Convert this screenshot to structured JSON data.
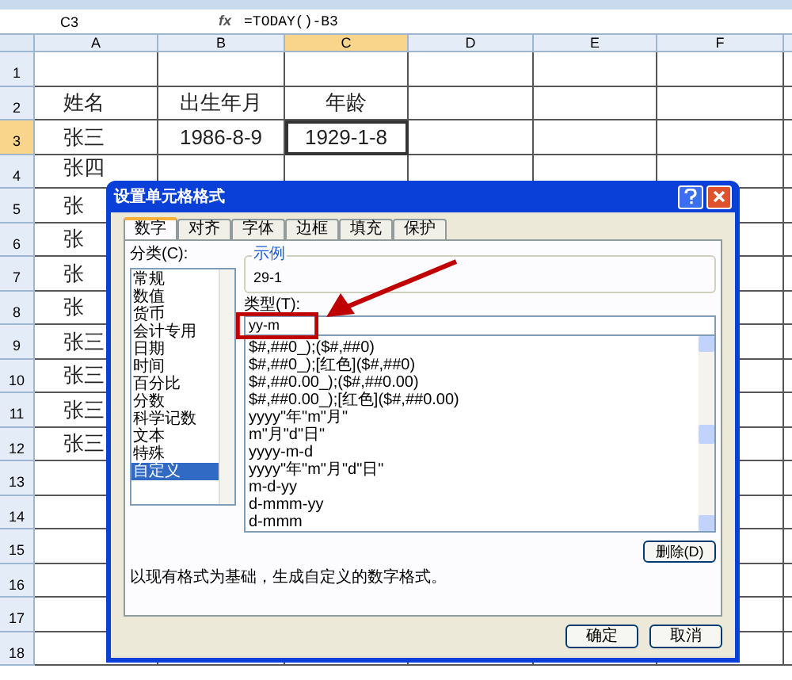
{
  "formula_bar": {
    "name_box": "C3",
    "fx": "fx",
    "formula": "=TODAY()-B3"
  },
  "sheet": {
    "columns": [
      {
        "label": "A",
        "selected": false
      },
      {
        "label": "B",
        "selected": false
      },
      {
        "label": "C",
        "selected": true
      },
      {
        "label": "D",
        "selected": false
      },
      {
        "label": "E",
        "selected": false
      },
      {
        "label": "F",
        "selected": false
      }
    ],
    "rows": [
      {
        "number": "1",
        "selected": false,
        "cells": []
      },
      {
        "number": "2",
        "selected": false,
        "cells": [
          {
            "text": "姓名",
            "active": false
          },
          {
            "text": "出生年月",
            "active": false
          },
          {
            "text": "年龄",
            "active": false
          }
        ]
      },
      {
        "number": "3",
        "selected": true,
        "cells": [
          {
            "text": "张三",
            "active": false
          },
          {
            "text": "1986-8-9",
            "active": false
          },
          {
            "text": "1929-1-8",
            "active": true
          }
        ]
      },
      {
        "number": "4",
        "selected": false,
        "cells": [
          {
            "text": "张四",
            "active": false
          }
        ]
      },
      {
        "number": "5",
        "selected": false,
        "cells": [
          {
            "text": "张",
            "active": false
          }
        ]
      },
      {
        "number": "6",
        "selected": false,
        "cells": [
          {
            "text": "张",
            "active": false
          }
        ]
      },
      {
        "number": "7",
        "selected": false,
        "cells": [
          {
            "text": "张",
            "active": false
          }
        ]
      },
      {
        "number": "8",
        "selected": false,
        "cells": [
          {
            "text": "张",
            "active": false
          }
        ]
      },
      {
        "number": "9",
        "selected": false,
        "cells": [
          {
            "text": "张三",
            "active": false
          }
        ]
      },
      {
        "number": "10",
        "selected": false,
        "cells": [
          {
            "text": "张三",
            "active": false
          }
        ]
      },
      {
        "number": "11",
        "selected": false,
        "cells": [
          {
            "text": "张三",
            "active": false
          }
        ]
      },
      {
        "number": "12",
        "selected": false,
        "cells": [
          {
            "text": "张三",
            "active": false
          }
        ]
      },
      {
        "number": "13",
        "selected": false,
        "cells": []
      },
      {
        "number": "14",
        "selected": false,
        "cells": []
      },
      {
        "number": "15",
        "selected": false,
        "cells": []
      },
      {
        "number": "16",
        "selected": false,
        "cells": []
      },
      {
        "number": "17",
        "selected": false,
        "cells": []
      },
      {
        "number": "18",
        "selected": false,
        "cells": []
      }
    ]
  },
  "dialog": {
    "title": "设置单元格格式",
    "tabs": [
      {
        "label": "数字",
        "selected": true
      },
      {
        "label": "对齐",
        "selected": false
      },
      {
        "label": "字体",
        "selected": false
      },
      {
        "label": "边框",
        "selected": false
      },
      {
        "label": "填充",
        "selected": false
      },
      {
        "label": "保护",
        "selected": false
      }
    ],
    "category_label": "分类(C):",
    "categories": [
      {
        "label": "常规",
        "selected": false
      },
      {
        "label": "数值",
        "selected": false
      },
      {
        "label": "货币",
        "selected": false
      },
      {
        "label": "会计专用",
        "selected": false
      },
      {
        "label": "日期",
        "selected": false
      },
      {
        "label": "时间",
        "selected": false
      },
      {
        "label": "百分比",
        "selected": false
      },
      {
        "label": "分数",
        "selected": false
      },
      {
        "label": "科学记数",
        "selected": false
      },
      {
        "label": "文本",
        "selected": false
      },
      {
        "label": "特殊",
        "selected": false
      },
      {
        "label": "自定义",
        "selected": true
      }
    ],
    "sample_label": "示例",
    "sample_value": "29-1",
    "type_label": "类型(T):",
    "type_value": "yy-m",
    "formats": [
      "$#,##0_);($#,##0)",
      "$#,##0_);[红色]($#,##0)",
      "$#,##0.00_);($#,##0.00)",
      "$#,##0.00_);[红色]($#,##0.00)",
      "yyyy\"年\"m\"月\"",
      "m\"月\"d\"日\"",
      "yyyy-m-d",
      "yyyy\"年\"m\"月\"d\"日\"",
      "m-d-yy",
      "d-mmm-yy",
      "d-mmm"
    ],
    "delete_button": "删除(D)",
    "description": "以现有格式为基础，生成自定义的数字格式。",
    "ok_button": "确定",
    "cancel_button": "取消"
  }
}
